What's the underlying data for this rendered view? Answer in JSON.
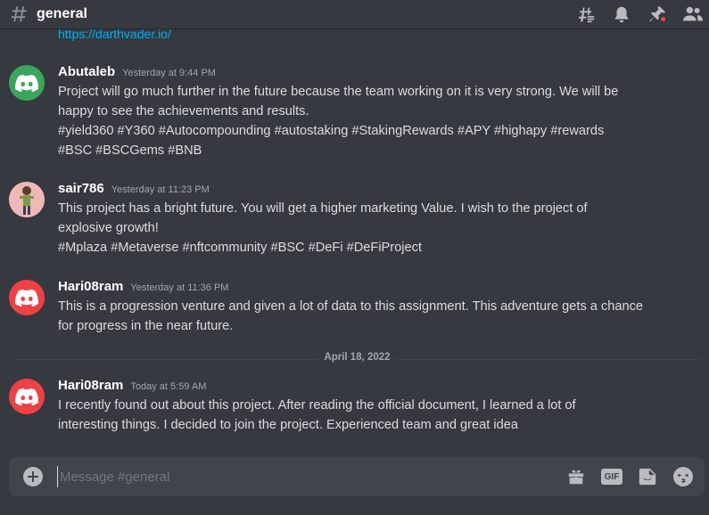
{
  "header": {
    "channel_name": "general"
  },
  "top_link": "https://darthvader.io/",
  "messages": [
    {
      "username": "Abutaleb",
      "timestamp": "Yesterday at 9:44 PM",
      "avatar_color": "#3ba55c",
      "lines": [
        "Project will go much further in the future because the team working on it is very strong. We will be",
        "happy to see the achievements and results.",
        "#yield360 #Y360 #Autocompounding #autostaking #StakingRewards #APY #highapy #rewards",
        "#BSC #BSCGems #BNB"
      ]
    },
    {
      "username": "sair786",
      "timestamp": "Yesterday at 11:23 PM",
      "avatar_color": "#e8a0a0",
      "lines": [
        "This project has a bright future. You will get a higher marketing Value. I wish to the project of",
        "explosive growth!",
        "#Mplaza #Metaverse #nftcommunity #BSC  #DeFi #DeFiProject"
      ]
    },
    {
      "username": "Hari08ram",
      "timestamp": "Yesterday at 11:36 PM",
      "avatar_color": "#ed4245",
      "lines": [
        "This is a progression venture and given a lot of data to this assignment. This adventure gets a chance",
        "for progress in the near future."
      ]
    },
    {
      "username": "Hari08ram",
      "timestamp": "Today at 5:59 AM",
      "avatar_color": "#ed4245",
      "lines": [
        "I recently found out about this project. After reading the official document, I learned a lot of",
        "interesting things. I decided to join the project. Experienced team and great idea"
      ]
    }
  ],
  "date_divider": "April 18, 2022",
  "composer": {
    "placeholder": "Message #general",
    "gif_label": "GIF"
  },
  "icons": {
    "header": [
      "threads-icon",
      "bell-icon",
      "pin-icon",
      "members-icon"
    ],
    "composer": [
      "plus-icon",
      "gift-icon",
      "gif-icon",
      "sticker-icon",
      "emoji-icon"
    ]
  },
  "colors": {
    "background": "#36393f",
    "composer": "#40444b",
    "link": "#00aff4",
    "notification": "#ed4245"
  }
}
